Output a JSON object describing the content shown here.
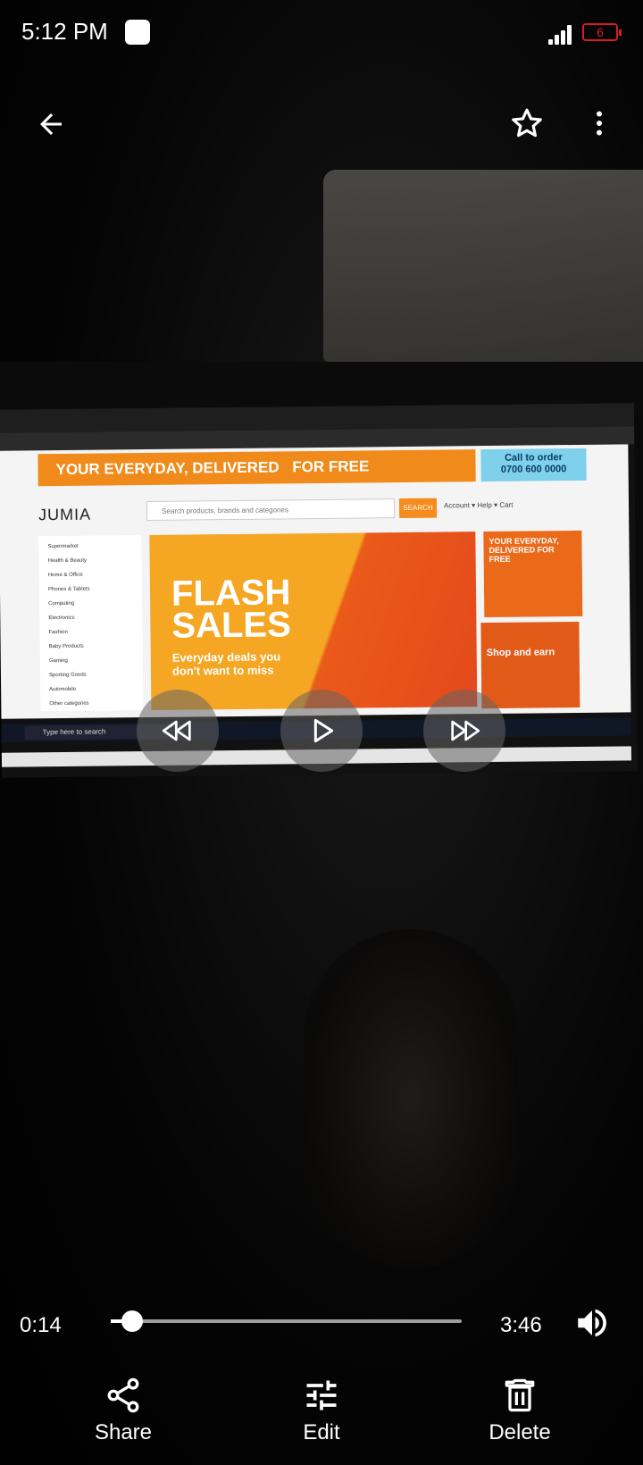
{
  "status_bar": {
    "time": "5:12 PM",
    "battery": "6"
  },
  "top_bar": {
    "back_icon": "arrow-left-icon",
    "favorite_icon": "star-outline-icon",
    "more_icon": "more-vert-icon"
  },
  "screen_content": {
    "banner_text": "YOUR EVERYDAY, DELIVERED",
    "banner_free": "FOR FREE",
    "call_to_order": "Call to order",
    "phone": "0700 600 0000",
    "logo": "JUMIA",
    "search_placeholder": "Search products, brands and categories",
    "search_button": "SEARCH",
    "account_links": "Account  ▾   Help  ▾   Cart",
    "categories": [
      "Supermarket",
      "Health & Beauty",
      "Home & Office",
      "Phones & Tablets",
      "Computing",
      "Electronics",
      "Fashion",
      "Baby Products",
      "Gaming",
      "Sporting Goods",
      "Automobile",
      "Other categories"
    ],
    "flash_title": "FLASH SALES",
    "flash_subtitle": "Everyday deals you don't want to miss",
    "promo1": "YOUR EVERYDAY, DELIVERED FOR FREE",
    "promo2": "Shop and earn",
    "taskbar_search": "Type here to search"
  },
  "player": {
    "current_time": "0:14",
    "total_time": "3:46",
    "progress": 0.062
  },
  "actions": [
    {
      "label": "Share",
      "icon": "share-icon"
    },
    {
      "label": "Edit",
      "icon": "tune-icon"
    },
    {
      "label": "Delete",
      "icon": "delete-icon"
    }
  ]
}
